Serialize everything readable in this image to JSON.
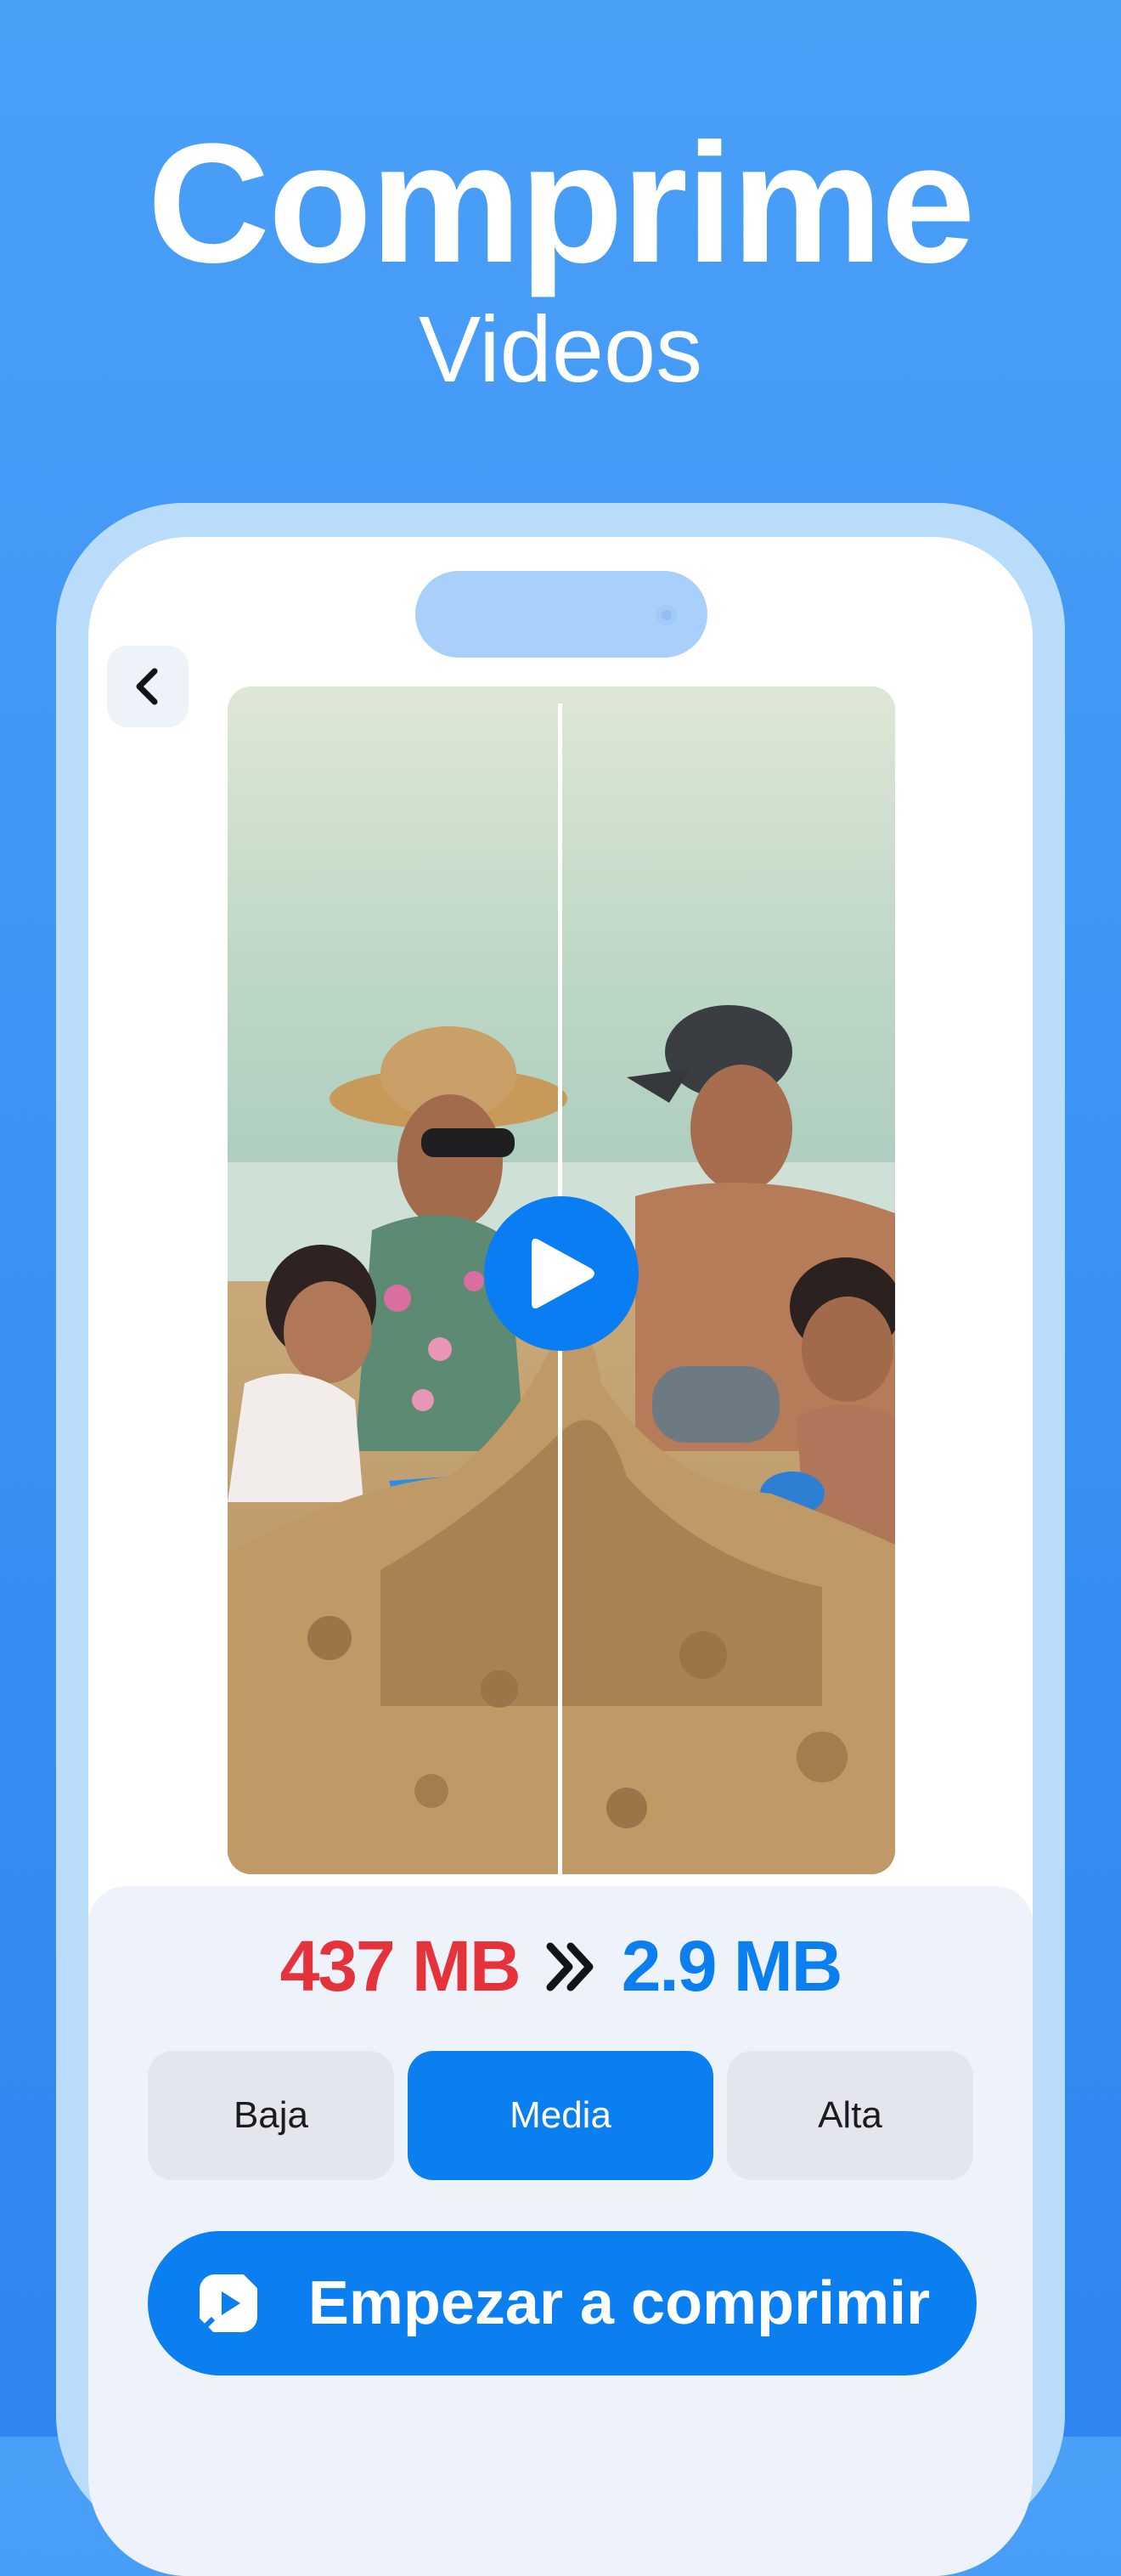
{
  "hero": {
    "title": "Comprime",
    "subtitle": "Videos"
  },
  "compression": {
    "original_size": "437 MB",
    "compressed_size": "2.9 MB",
    "arrow_icon": "double-chevron-right-icon"
  },
  "quality_options": [
    {
      "label": "Baja",
      "selected": false
    },
    {
      "label": "Media",
      "selected": true
    },
    {
      "label": "Alta",
      "selected": false
    }
  ],
  "action": {
    "label": "Empezar a comprimir",
    "icon": "video-compress-icon"
  },
  "icons": {
    "back": "chevron-left-icon",
    "play": "play-icon"
  },
  "colors": {
    "background": "#3b92f3",
    "accent": "#0b7ef0",
    "original_size": "#e5333b",
    "panel": "#edf2fb"
  }
}
